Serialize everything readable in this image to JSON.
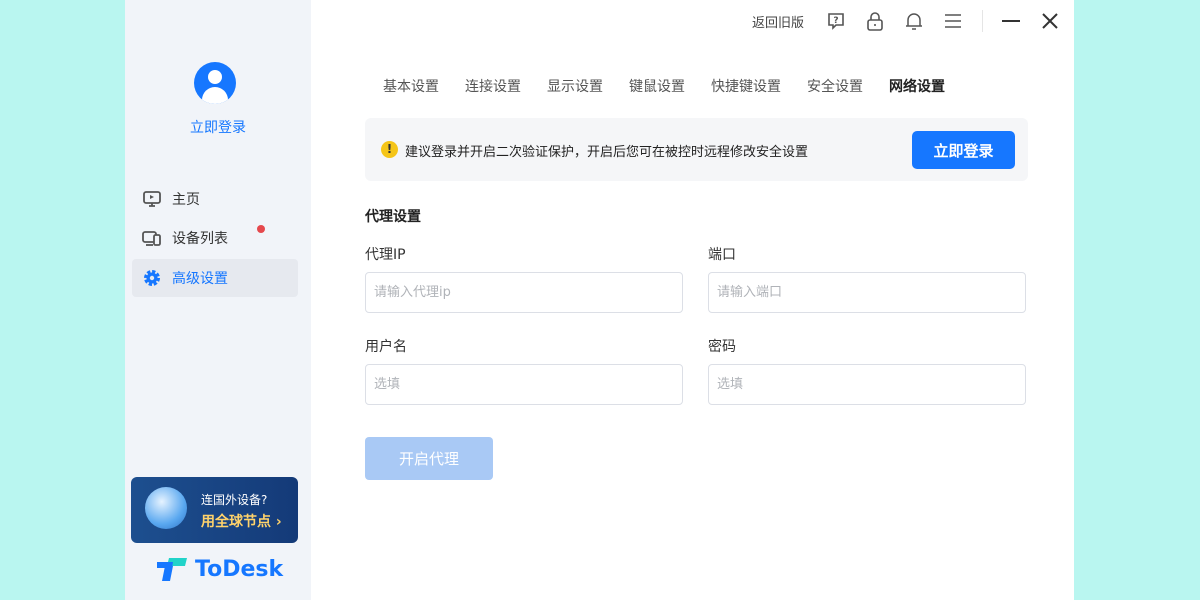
{
  "sidebar": {
    "login": "立即登录",
    "items": [
      {
        "label": "主页"
      },
      {
        "label": "设备列表"
      },
      {
        "label": "高级设置"
      }
    ],
    "promo": {
      "line1": "连国外设备?",
      "line2": "用全球节点 ›"
    },
    "logo": "ToDesk"
  },
  "topbar": {
    "back": "返回旧版"
  },
  "tabs": [
    "基本设置",
    "连接设置",
    "显示设置",
    "键鼠设置",
    "快捷键设置",
    "安全设置",
    "网络设置"
  ],
  "banner": {
    "message": "建议登录并开启二次验证保护，开启后您可在被控时远程修改安全设置",
    "button": "立即登录"
  },
  "proxy": {
    "title": "代理设置",
    "ip_label": "代理IP",
    "ip_placeholder": "请输入代理ip",
    "port_label": "端口",
    "port_placeholder": "请输入端口",
    "user_label": "用户名",
    "user_placeholder": "选填",
    "pass_label": "密码",
    "pass_placeholder": "选填",
    "button": "开启代理"
  },
  "colors": {
    "accent": "#1677ff"
  }
}
